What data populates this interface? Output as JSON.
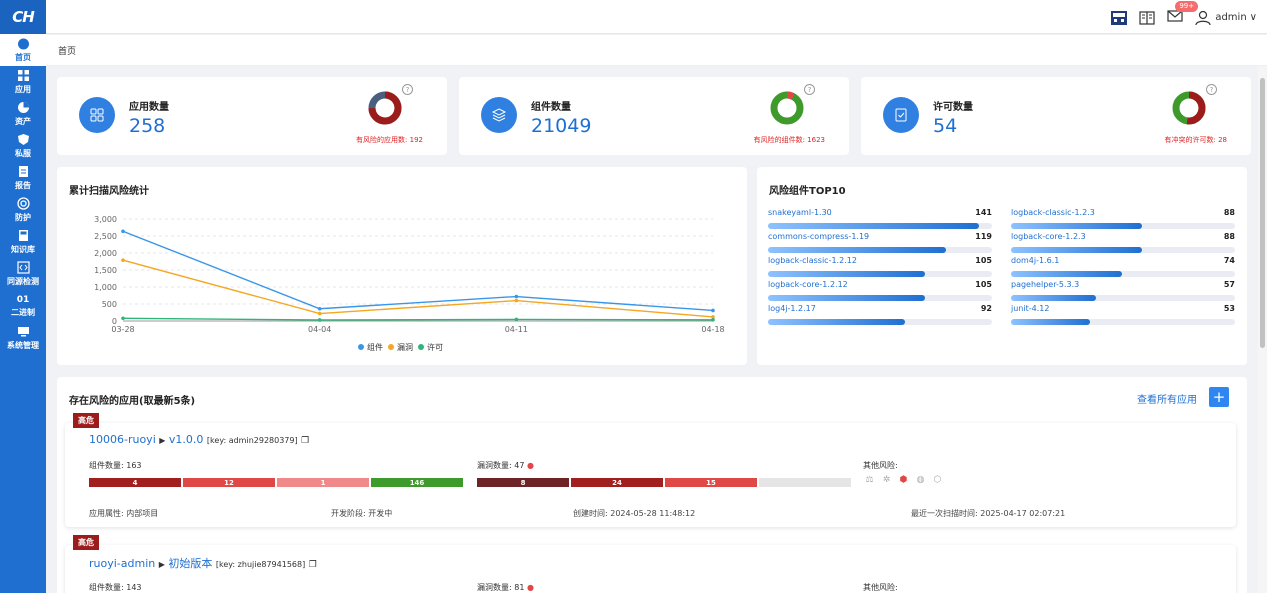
{
  "sidebar": {
    "logo": "CH",
    "items": [
      {
        "label": "首页",
        "icon": "dashboard-icon",
        "active": true
      },
      {
        "label": "应用",
        "icon": "apps-icon"
      },
      {
        "label": "资产",
        "icon": "pie-icon"
      },
      {
        "label": "私服",
        "icon": "shield-icon"
      },
      {
        "label": "报告",
        "icon": "report-icon"
      },
      {
        "label": "防护",
        "icon": "target-icon"
      },
      {
        "label": "知识库",
        "icon": "book-icon"
      },
      {
        "label": "同源检测",
        "icon": "code-icon"
      },
      {
        "label": "二进制",
        "icon": "binary-icon",
        "glyph": "01"
      },
      {
        "label": "系统管理",
        "icon": "monitor-icon"
      }
    ]
  },
  "header": {
    "badge": "99+",
    "user": "admin",
    "breadcrumb": "首页"
  },
  "stats": [
    {
      "label": "应用数量",
      "value": "258",
      "note": "有风险的应用数: 192",
      "risk_fraction": 0.744
    },
    {
      "label": "组件数量",
      "value": "21049",
      "note": "有风险的组件数: 1623",
      "risk_fraction": 0.077
    },
    {
      "label": "许可数量",
      "value": "54",
      "note": "有冲突的许可数: 28",
      "risk_fraction": 0.519
    }
  ],
  "colors": {
    "primary": "#1f6fd1",
    "risk": "#9c1b1b",
    "safe": "#3e9a2a",
    "donut_other": "#4a5f80"
  },
  "trend": {
    "title": "累计扫描风险统计",
    "chart_data": {
      "type": "line",
      "x": [
        "03-28",
        "04-04",
        "04-11",
        "04-18"
      ],
      "yticks": [
        "3,000",
        "2,500",
        "2,000",
        "1,500",
        "1,000",
        "500",
        "0"
      ],
      "ylim": [
        0,
        3000
      ],
      "series": [
        {
          "name": "组件",
          "color": "#3a96e8",
          "values": [
            2640,
            360,
            720,
            310
          ]
        },
        {
          "name": "漏洞",
          "color": "#f5a623",
          "values": [
            1790,
            220,
            600,
            120
          ]
        },
        {
          "name": "许可",
          "color": "#2db57a",
          "values": [
            80,
            30,
            45,
            35
          ]
        }
      ],
      "legend": "bottom"
    }
  },
  "top10": {
    "title": "风险组件TOP10",
    "max": 150,
    "items": [
      {
        "name": "snakeyaml-1.30",
        "count": 141
      },
      {
        "name": "logback-classic-1.2.3",
        "count": 88
      },
      {
        "name": "commons-compress-1.19",
        "count": 119
      },
      {
        "name": "logback-core-1.2.3",
        "count": 88
      },
      {
        "name": "logback-classic-1.2.12",
        "count": 105
      },
      {
        "name": "dom4j-1.6.1",
        "count": 74
      },
      {
        "name": "logback-core-1.2.12",
        "count": 105
      },
      {
        "name": "pagehelper-5.3.3",
        "count": 57
      },
      {
        "name": "log4j-1.2.17",
        "count": 92
      },
      {
        "name": "junit-4.12",
        "count": 53
      }
    ]
  },
  "apps": {
    "title": "存在风险的应用(取最新5条)",
    "view_all": "查看所有应用",
    "list": [
      {
        "level": "高危",
        "name": "10006-ruoyi",
        "arrow": "▶",
        "version": "v1.0.0",
        "key": "[key: admin29280379]",
        "components": "组件数量: 163",
        "vulns": "漏洞数量: 47",
        "other": "其他风险:",
        "comp_segments": [
          {
            "label": "4",
            "color": "#a11f1f",
            "value": 92
          },
          {
            "label": "12",
            "color": "#e04848",
            "value": 92
          },
          {
            "label": "1",
            "color": "#f08a8a",
            "value": 92
          },
          {
            "label": "146",
            "color": "#3e9a2a",
            "value": 92
          }
        ],
        "vuln_segments": [
          {
            "label": "8",
            "color": "#6e2424",
            "value": 92
          },
          {
            "label": "24",
            "color": "#a11f1f",
            "value": 92
          },
          {
            "label": "15",
            "color": "#e04848",
            "value": 92
          },
          {
            "label": "",
            "color": "#e5e5e5",
            "value": 92
          }
        ],
        "attr": "应用属性: 内部项目",
        "stage": "开发阶段: 开发中",
        "created": "创建时间: 2024-05-28 11:48:12",
        "scanned": "最近一次扫描时间: 2025-04-17 02:07:21"
      },
      {
        "level": "高危",
        "name": "ruoyi-admin",
        "arrow": "▶",
        "version": "初始版本",
        "key": "[key: zhujie87941568]",
        "components": "组件数量: 143",
        "vulns": "漏洞数量: 81",
        "other": "其他风险:"
      }
    ]
  }
}
